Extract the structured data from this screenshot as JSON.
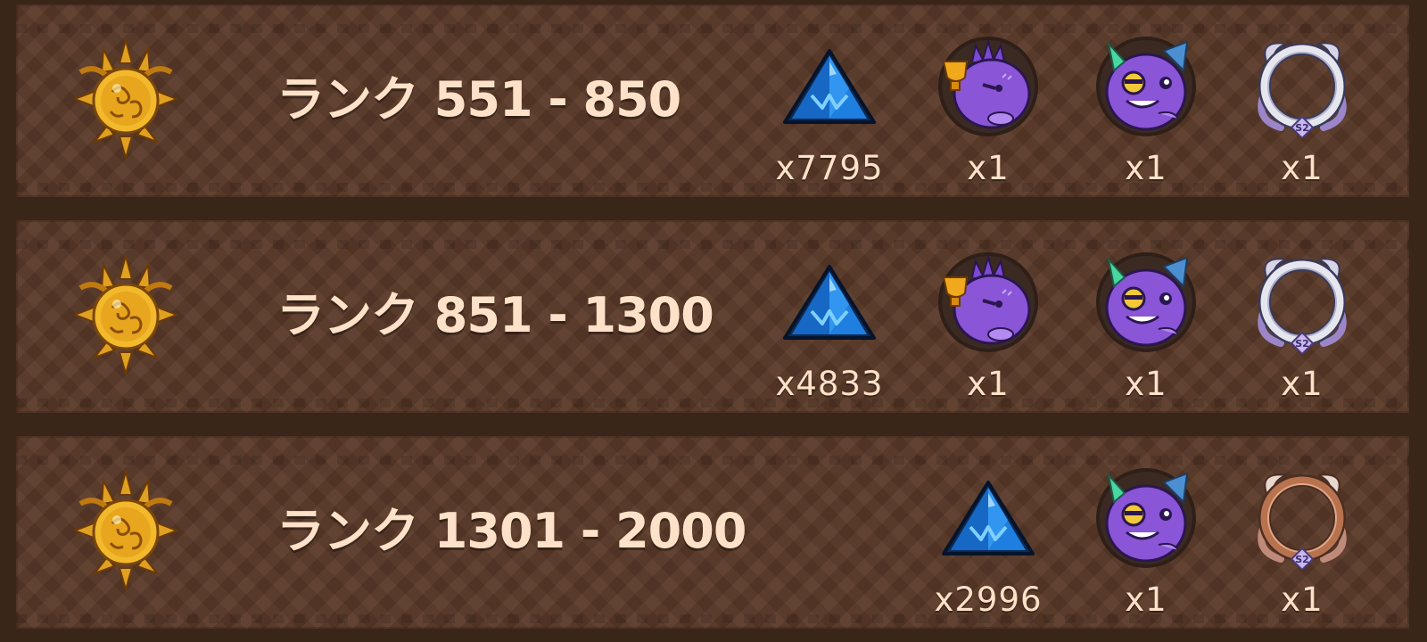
{
  "tiers": [
    {
      "rank_label": "ランク 551 - 850",
      "rewards": [
        {
          "item": "crystal-icon",
          "count": "x7795"
        },
        {
          "item": "trophy-axie-avatar-icon",
          "count": "x1"
        },
        {
          "item": "horned-axie-avatar-icon",
          "count": "x1"
        },
        {
          "item": "silver-frame-icon",
          "count": "x1"
        }
      ]
    },
    {
      "rank_label": "ランク 851 - 1300",
      "rewards": [
        {
          "item": "crystal-icon",
          "count": "x4833"
        },
        {
          "item": "trophy-axie-avatar-icon",
          "count": "x1"
        },
        {
          "item": "horned-axie-avatar-icon",
          "count": "x1"
        },
        {
          "item": "silver-frame-icon",
          "count": "x1"
        }
      ]
    },
    {
      "rank_label": "ランク 1301 - 2000",
      "rewards": [
        {
          "item": "crystal-icon",
          "count": "x2996"
        },
        {
          "item": "horned-axie-avatar-icon",
          "count": "x1"
        },
        {
          "item": "bronze-frame-icon",
          "count": "x1"
        }
      ]
    }
  ],
  "frame_badge_text": "S2",
  "colors": {
    "row_bg": "#5b3a29",
    "text": "#fde2c9",
    "crystal": "#1f7fe0",
    "axie_purple": "#8a55d6",
    "gold": "#e3a52a"
  }
}
